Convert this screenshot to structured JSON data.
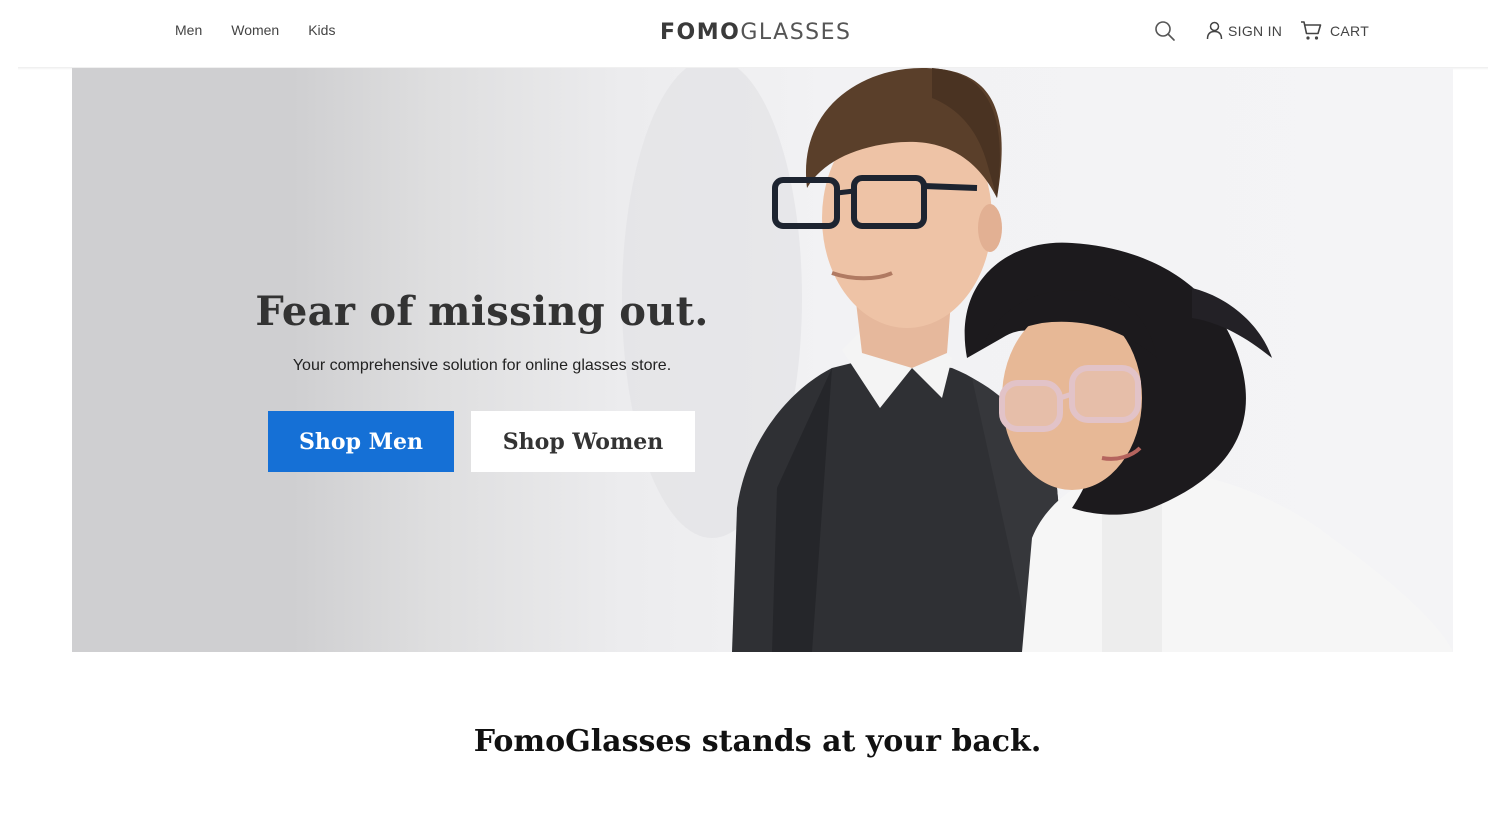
{
  "header": {
    "nav": [
      {
        "label": "Men"
      },
      {
        "label": "Women"
      },
      {
        "label": "Kids"
      }
    ],
    "logo": {
      "bold": "FOMO",
      "light": "GLASSES"
    },
    "search_icon": "search-icon",
    "sign_in_label": "SIGN IN",
    "cart_label": "CART"
  },
  "hero": {
    "title": "Fear of missing out.",
    "subtitle": "Your comprehensive solution for online glasses store.",
    "shop_men_label": "Shop Men",
    "shop_women_label": "Shop Women",
    "image": "couple-wearing-glasses-photo"
  },
  "section": {
    "tagline": "FomoGlasses stands at your back."
  },
  "colors": {
    "accent": "#1570d6",
    "text": "#333333",
    "hero_bg": "#f2f2f4"
  }
}
